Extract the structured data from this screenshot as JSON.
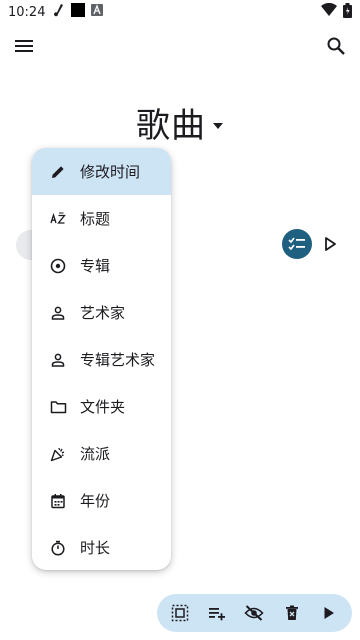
{
  "status_bar": {
    "time": "10:24",
    "icons": [
      "music-note-icon",
      "black-square-icon",
      "text-a-icon"
    ],
    "right_icons": [
      "wifi-icon",
      "battery-icon"
    ]
  },
  "app_bar": {
    "menu_icon": "hamburger-menu-icon",
    "search_icon": "search-icon"
  },
  "header": {
    "title": "歌曲",
    "dropdown_icon": "arrow-drop-down-icon"
  },
  "sort_menu": {
    "items": [
      {
        "label": "修改时间",
        "icon": "pencil-icon",
        "active": true
      },
      {
        "label": "标题",
        "icon": "sort-az-icon",
        "active": false
      },
      {
        "label": "专辑",
        "icon": "album-icon",
        "active": false
      },
      {
        "label": "艺术家",
        "icon": "person-icon",
        "active": false
      },
      {
        "label": "专辑艺术家",
        "icon": "person-icon",
        "active": false
      },
      {
        "label": "文件夹",
        "icon": "folder-icon",
        "active": false
      },
      {
        "label": "流派",
        "icon": "party-popper-icon",
        "active": false
      },
      {
        "label": "年份",
        "icon": "calendar-icon",
        "active": false
      },
      {
        "label": "时长",
        "icon": "timer-icon",
        "active": false
      }
    ]
  },
  "list_controls": {
    "select_icon": "checklist-icon",
    "play_icon": "play-icon"
  },
  "bottom_toolbar": {
    "buttons": [
      "select-all-icon",
      "playlist-add-icon",
      "visibility-off-icon",
      "delete-icon",
      "play-icon"
    ]
  },
  "colors": {
    "accent": "#cde4f5",
    "select_circle": "#1f5f80",
    "text": "#1d1b20"
  }
}
